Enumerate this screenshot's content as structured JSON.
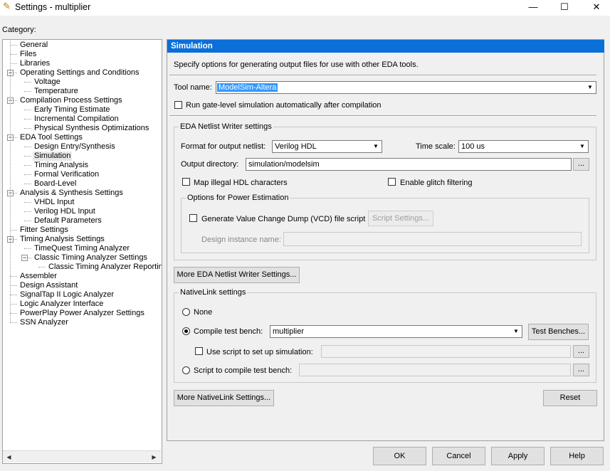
{
  "window": {
    "title": "Settings - multiplier",
    "minimize": "—",
    "maximize": "☐",
    "close": "✕"
  },
  "category": {
    "label": "Category:",
    "items": [
      {
        "label": "General",
        "level": 1,
        "expander": ""
      },
      {
        "label": "Files",
        "level": 1,
        "expander": ""
      },
      {
        "label": "Libraries",
        "level": 1,
        "expander": ""
      },
      {
        "label": "Operating Settings and Conditions",
        "level": 1,
        "expander": "-"
      },
      {
        "label": "Voltage",
        "level": 2,
        "expander": ""
      },
      {
        "label": "Temperature",
        "level": 2,
        "expander": ""
      },
      {
        "label": "Compilation Process Settings",
        "level": 1,
        "expander": "-"
      },
      {
        "label": "Early Timing Estimate",
        "level": 2,
        "expander": ""
      },
      {
        "label": "Incremental Compilation",
        "level": 2,
        "expander": ""
      },
      {
        "label": "Physical Synthesis Optimizations",
        "level": 2,
        "expander": ""
      },
      {
        "label": "EDA Tool Settings",
        "level": 1,
        "expander": "-"
      },
      {
        "label": "Design Entry/Synthesis",
        "level": 2,
        "expander": ""
      },
      {
        "label": "Simulation",
        "level": 2,
        "expander": "",
        "selected": true
      },
      {
        "label": "Timing Analysis",
        "level": 2,
        "expander": ""
      },
      {
        "label": "Formal Verification",
        "level": 2,
        "expander": ""
      },
      {
        "label": "Board-Level",
        "level": 2,
        "expander": ""
      },
      {
        "label": "Analysis & Synthesis Settings",
        "level": 1,
        "expander": "-"
      },
      {
        "label": "VHDL Input",
        "level": 2,
        "expander": ""
      },
      {
        "label": "Verilog HDL Input",
        "level": 2,
        "expander": ""
      },
      {
        "label": "Default Parameters",
        "level": 2,
        "expander": ""
      },
      {
        "label": "Fitter Settings",
        "level": 1,
        "expander": ""
      },
      {
        "label": "Timing Analysis Settings",
        "level": 1,
        "expander": "-"
      },
      {
        "label": "TimeQuest Timing Analyzer",
        "level": 2,
        "expander": ""
      },
      {
        "label": "Classic Timing Analyzer Settings",
        "level": 2,
        "expander": "-"
      },
      {
        "label": "Classic Timing Analyzer Reporting",
        "level": 3,
        "expander": ""
      },
      {
        "label": "Assembler",
        "level": 1,
        "expander": ""
      },
      {
        "label": "Design Assistant",
        "level": 1,
        "expander": ""
      },
      {
        "label": "SignalTap II Logic Analyzer",
        "level": 1,
        "expander": ""
      },
      {
        "label": "Logic Analyzer Interface",
        "level": 1,
        "expander": ""
      },
      {
        "label": "PowerPlay Power Analyzer Settings",
        "level": 1,
        "expander": ""
      },
      {
        "label": "SSN Analyzer",
        "level": 1,
        "expander": ""
      }
    ],
    "scroll_left": "◀",
    "scroll_right": "▶"
  },
  "panel": {
    "title": "Simulation",
    "description": "Specify options for generating output files for use with other EDA tools.",
    "tool_name_label": "Tool name:",
    "tool_name_value": "ModelSim-Altera",
    "run_gate_level_label": "Run gate-level simulation automatically after compilation",
    "eda_netlist": {
      "title": "EDA Netlist Writer settings",
      "format_label": "Format for output netlist:",
      "format_value": "Verilog HDL",
      "time_scale_label": "Time scale:",
      "time_scale_value": "100 us",
      "output_dir_label": "Output directory:",
      "output_dir_value": "simulation/modelsim",
      "browse": "...",
      "map_illegal_label": "Map illegal HDL characters",
      "glitch_label": "Enable glitch filtering",
      "power": {
        "title": "Options for Power Estimation",
        "vcd_label": "Generate Value Change Dump (VCD) file script",
        "script_settings": "Script Settings...",
        "instance_label": "Design instance name:",
        "instance_value": ""
      }
    },
    "more_eda": "More EDA Netlist Writer Settings...",
    "nativelink": {
      "title": "NativeLink settings",
      "none_label": "None",
      "compile_tb_label": "Compile test bench:",
      "compile_tb_value": "multiplier",
      "test_benches": "Test Benches...",
      "use_script_label": "Use script to set up simulation:",
      "use_script_value": "",
      "script_compile_label": "Script to compile test bench:",
      "script_compile_value": "",
      "browse": "..."
    },
    "more_nativelink": "More NativeLink Settings...",
    "reset": "Reset"
  },
  "footer": {
    "ok": "OK",
    "cancel": "Cancel",
    "apply": "Apply",
    "help": "Help"
  }
}
